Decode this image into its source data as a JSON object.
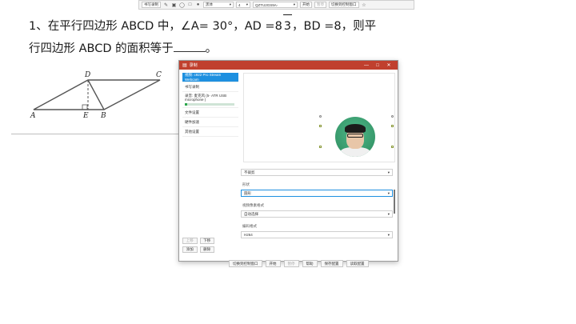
{
  "toolbar": {
    "app_label": "书写录制",
    "pen_icon": "pen-icon",
    "brush_icon": "brush-icon",
    "font_value": "黑体",
    "size_value": "4",
    "device_value": "QZTU2GS9A-",
    "start_label": "开始",
    "pause_label": "暂停",
    "switch_label": "切换到控制窗口",
    "pin_icon": "pin-icon"
  },
  "problem": {
    "line1_a": "1、在平行四边形 ABCD 中，∠A= 30°，AD =8",
    "line1_sqrt": "3",
    "line1_b": "，BD =8，则平",
    "line2": "行四边形 ABCD 的面积等于",
    "line2_end": "。"
  },
  "geometry": {
    "labels": [
      "D",
      "C",
      "A",
      "E",
      "B"
    ]
  },
  "record_window": {
    "title": "录制",
    "sidebar": [
      {
        "label": "视频: c922 Pro Stream Webcam"
      },
      {
        "label": "书写录制"
      },
      {
        "label": "录音: 麦克风 (5- ATR USB microphone )",
        "level": 0.05
      },
      {
        "label": "文件设置"
      },
      {
        "label": "硬件加速"
      },
      {
        "label": "其他设置"
      }
    ],
    "side_buttons": [
      "上移",
      "下移",
      "添加",
      "删除"
    ],
    "settings": {
      "select1": "不裁剪",
      "shape_label": "形状",
      "shape_value": "圆形",
      "pixel_label": "视频像素格式",
      "pixel_value": "自动选择",
      "codec_label": "编码格式",
      "codec_value": "H264"
    },
    "bottom_buttons": [
      "切换到控制窗口",
      "开始",
      "暂停",
      "帮助",
      "保存配置",
      "读取配置"
    ]
  }
}
